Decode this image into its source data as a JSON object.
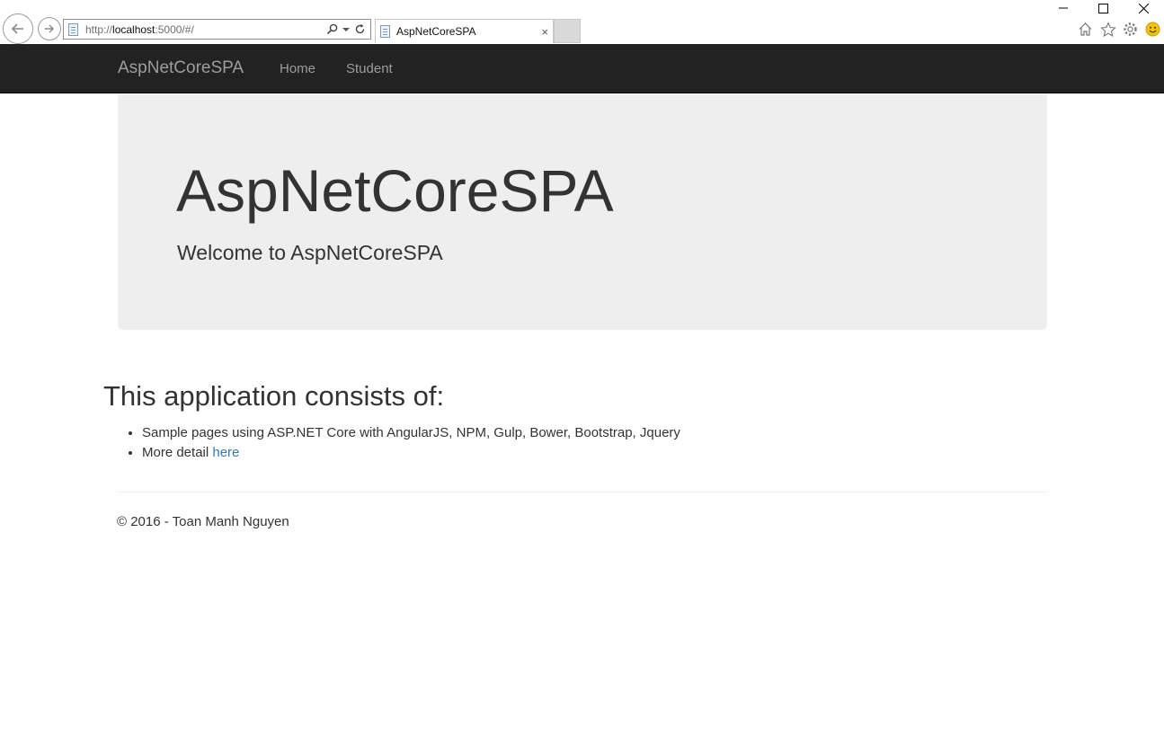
{
  "browser": {
    "url_prefix": "http://",
    "url_host": "localhost",
    "url_rest": ":5000/#/",
    "tab_title": "AspNetCoreSPA",
    "tab_close": "×",
    "icons": [
      "back-arrow-icon",
      "forward-arrow-icon",
      "page-icon",
      "search-icon",
      "dropdown-icon",
      "refresh-icon",
      "close-icon",
      "home-icon",
      "star-icon",
      "gear-icon",
      "smiley-icon",
      "minimize-icon",
      "maximize-icon"
    ]
  },
  "navbar": {
    "brand": "AspNetCoreSPA",
    "items": [
      {
        "label": "Home"
      },
      {
        "label": "Student"
      }
    ],
    "background": "#222222",
    "link_color": "#9d9d9d"
  },
  "jumbotron": {
    "title": "AspNetCoreSPA",
    "subtitle": "Welcome to AspNetCoreSPA",
    "background": "#eeeeee"
  },
  "content": {
    "heading": "This application consists of:",
    "items": [
      {
        "text": "Sample pages using ASP.NET Core with AngularJS, NPM, Gulp, Bower, Bootstrap, Jquery"
      },
      {
        "text": "More detail ",
        "link": "here"
      }
    ],
    "link_color": "#337ab7"
  },
  "footer": {
    "text": "© 2016 - Toan Manh Nguyen"
  }
}
